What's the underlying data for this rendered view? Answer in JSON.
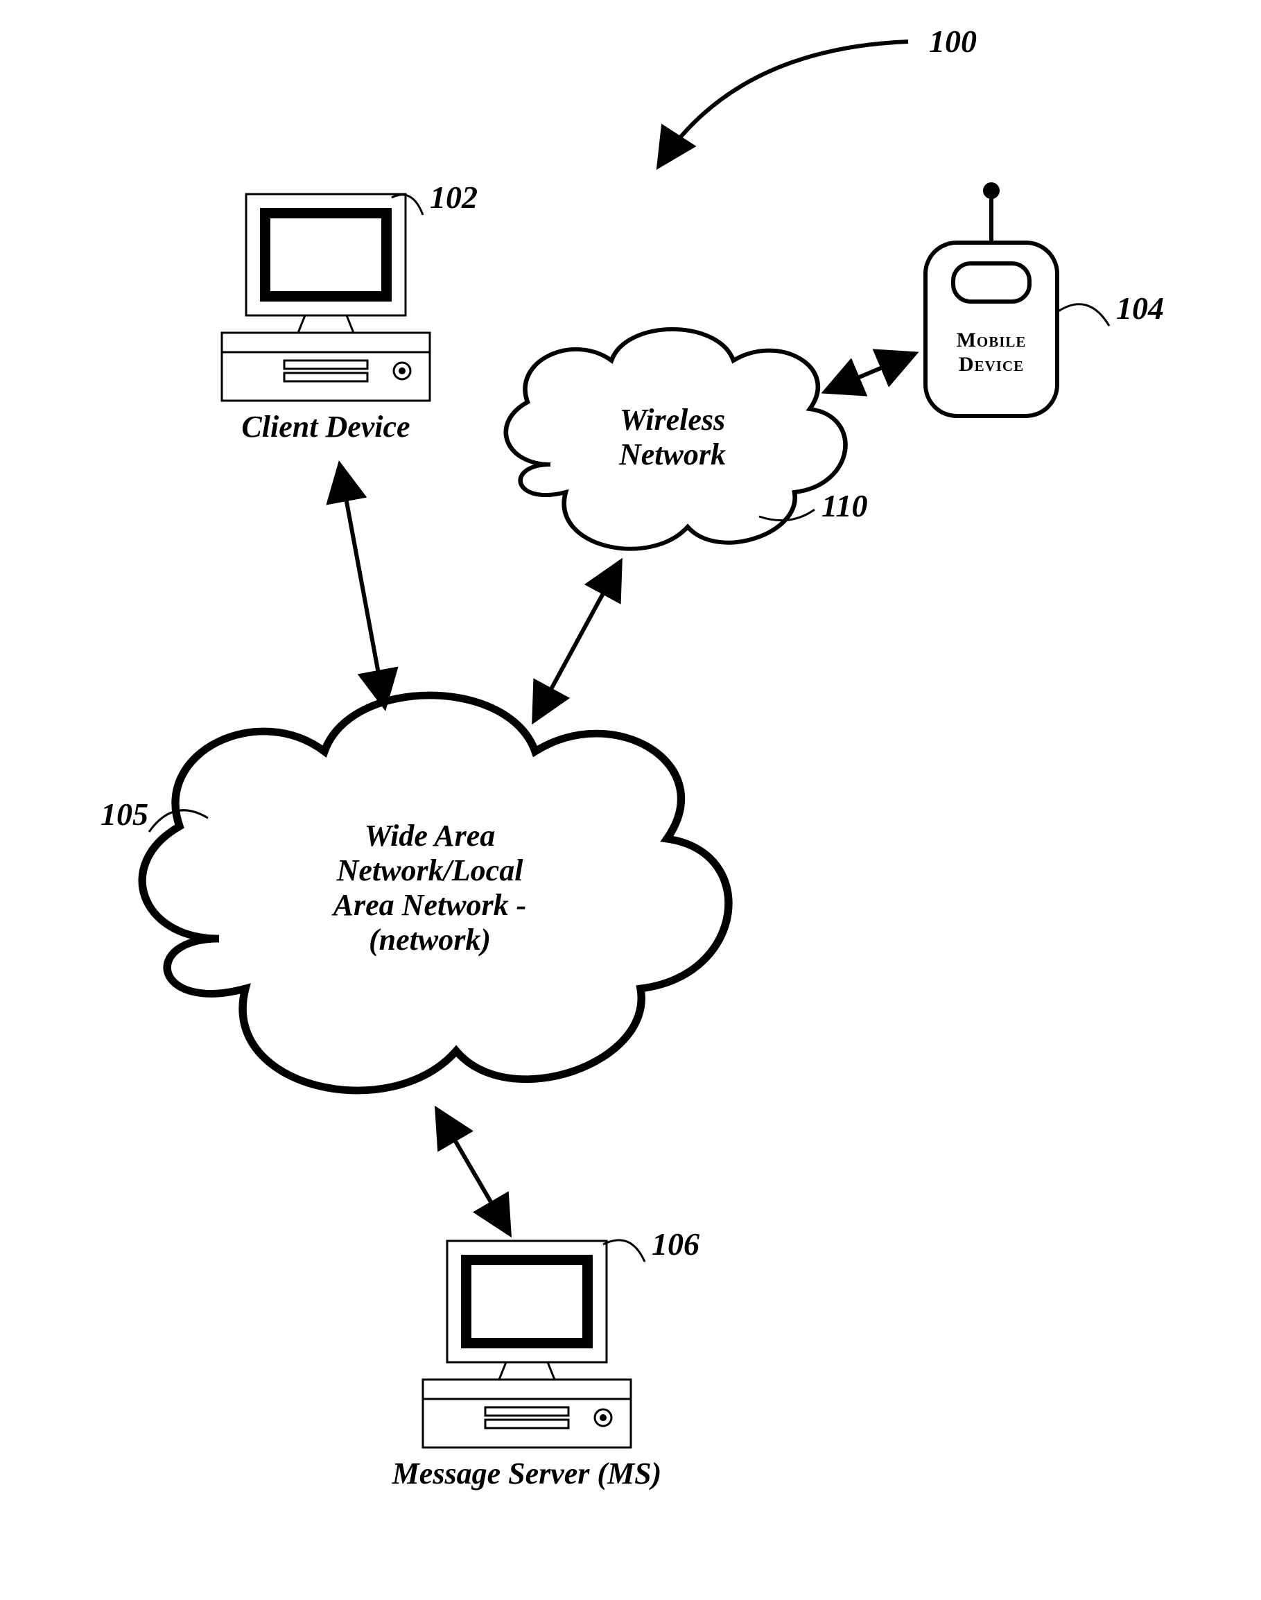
{
  "diagram": {
    "ref_system": "100",
    "client": {
      "label": "Client Device",
      "ref": "102"
    },
    "mobile": {
      "label_l1": "Mobile",
      "label_l2": "Device",
      "ref": "104"
    },
    "wan": {
      "l1": "Wide Area",
      "l2": "Network/Local",
      "l3": "Area Network -",
      "l4": "(network)",
      "ref": "105"
    },
    "server": {
      "label": "Message Server (MS)",
      "ref": "106"
    },
    "wireless": {
      "l1": "Wireless",
      "l2": "Network",
      "ref": "110"
    }
  }
}
